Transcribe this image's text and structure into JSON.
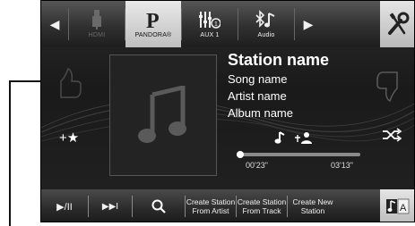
{
  "top_bar": {
    "prev_label": "◀",
    "next_label": "▶",
    "sources": [
      {
        "label": "HDMI",
        "icon": "usb-connector-icon",
        "active": false,
        "dim": true
      },
      {
        "label": "PANDORA®",
        "icon": "pandora-p-icon",
        "active": true,
        "dim": false
      },
      {
        "label": "AUX 1",
        "icon": "aux-mixer-icon",
        "active": false,
        "dim": false
      },
      {
        "label": "Audio",
        "icon": "bluetooth-music-icon",
        "active": false,
        "dim": false
      }
    ],
    "settings_icon": "wrench-screwdriver-icon"
  },
  "track": {
    "station": "Station name",
    "song": "Song name",
    "artist": "Artist name",
    "album": "Album name",
    "elapsed": "00'23\"",
    "total": "03'13\"",
    "progress_fraction": 0.03
  },
  "controls": {
    "thumbs_up_icon": "thumbs-up-icon",
    "thumbs_down_icon": "thumbs-down-icon",
    "bookmark_label": "+★",
    "shuffle_icon": "shuffle-icon",
    "album_art_icon": "music-note-icon",
    "badge_icons": [
      "music-note-icon",
      "artist-bookmark-icon"
    ]
  },
  "bottom_bar": {
    "play_pause": "▶/II",
    "skip": "▶▶I",
    "search_icon": "search-icon",
    "create_from_artist": [
      "Create Station",
      "From Artist"
    ],
    "create_from_track": [
      "Create Station",
      "From Track"
    ],
    "create_new": [
      "Create New",
      "Station"
    ],
    "mode_icon": "music-mode-icon"
  },
  "colors": {
    "background": "#1e1e1e",
    "bar_light": "#cfcfcf",
    "text": "#ffffff"
  }
}
